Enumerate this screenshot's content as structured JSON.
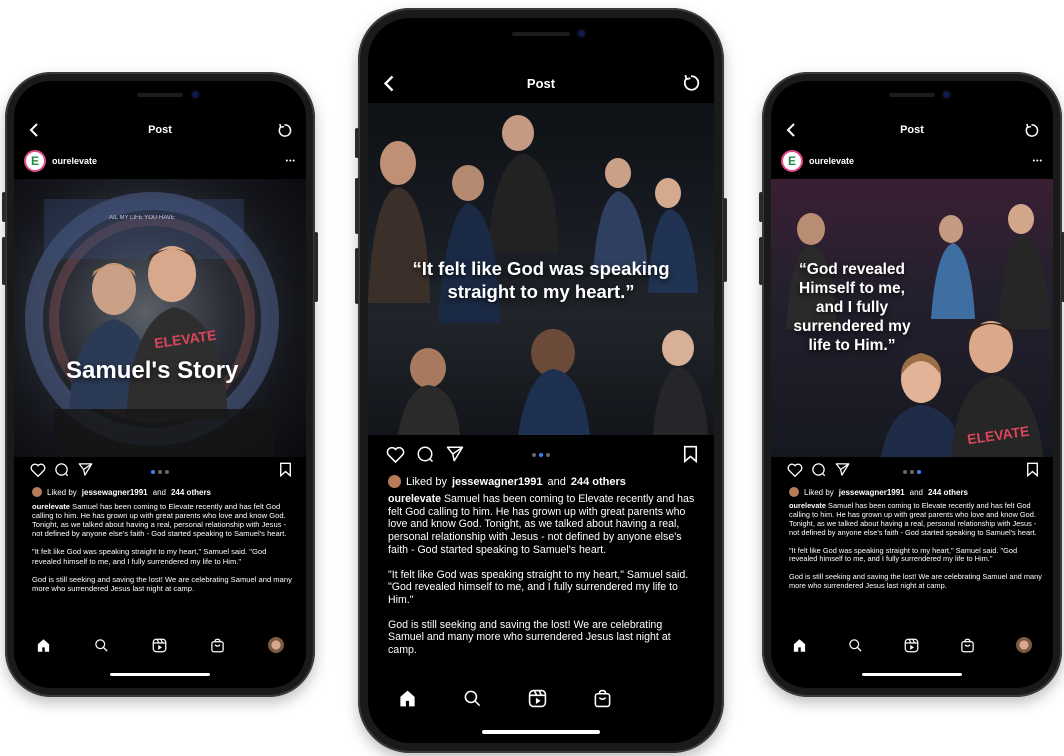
{
  "topbar": {
    "title": "Post"
  },
  "post": {
    "username": "ourelevate",
    "avatar_letter": "E",
    "more": "•••",
    "liked_prefix": "Liked by",
    "liked_user": "jessewagner1991",
    "liked_and": "and",
    "liked_others": "244 others",
    "caption_user": "ourelevate",
    "caption_p1": "Samuel has been coming to Elevate recently and has felt God calling to him. He has grown up with great parents who love and know God. Tonight, as we talked about having a real, personal relationship with Jesus - not defined by anyone else's faith - God started speaking to Samuel's heart.",
    "caption_p2": "\"It felt like God was speaking straight to my heart,\" Samuel said. \"God revealed himself to me, and I fully surrendered my life to Him.\"",
    "caption_p3": "God is still seeking and saving the lost! We are celebrating Samuel and many more who surrendered Jesus last night at camp."
  },
  "slides": {
    "left_title": "Samuel's Story",
    "left_sign": "AIL MY LIFE YOU HAVE",
    "left_shirt": "ELEVATE",
    "center_quote": "“It felt like God was speaking straight to my heart.”",
    "right_quote": "“God revealed Himself to me, and I fully surrendered my life to Him.”",
    "right_shirt": "ELEVATE"
  },
  "icons": [
    "back-icon",
    "refresh-icon",
    "heart-icon",
    "comment-icon",
    "share-icon",
    "bookmark-icon",
    "home-icon",
    "search-icon",
    "reels-icon",
    "shop-icon",
    "profile-avatar"
  ],
  "colors": {
    "accent_dot": "#3b82f6",
    "screen_bg": "#000000"
  }
}
